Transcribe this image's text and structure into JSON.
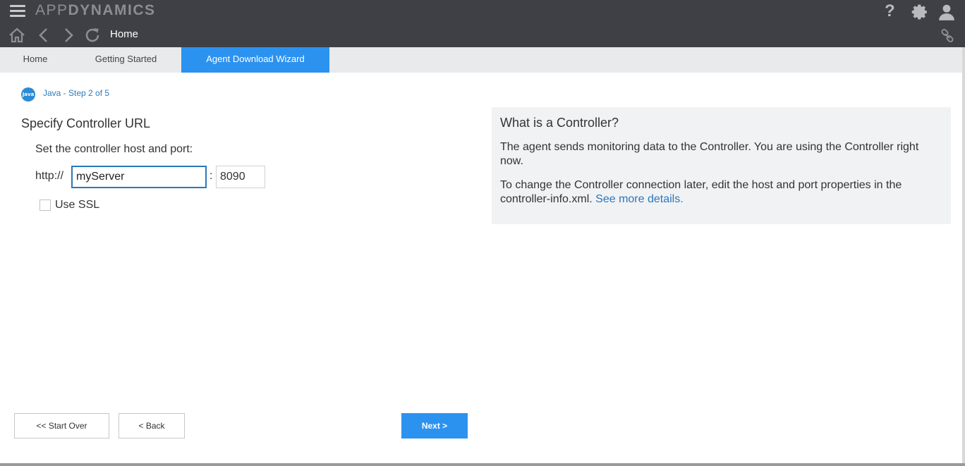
{
  "header": {
    "brand_light": "APP",
    "brand_bold": "DYNAMICS",
    "help_glyph": "?",
    "page_title": "Home",
    "icons": [
      "hamburger-menu-icon",
      "help-icon",
      "gear-icon",
      "user-icon",
      "home-icon",
      "back-arrow-icon",
      "forward-arrow-icon",
      "refresh-icon",
      "link-icon"
    ]
  },
  "tabs": [
    {
      "label": "Home",
      "active": false
    },
    {
      "label": "Getting Started",
      "active": false
    },
    {
      "label": "Agent Download Wizard",
      "active": true
    }
  ],
  "step": {
    "badge": "Java",
    "text": "Java - Step 2 of 5"
  },
  "form": {
    "title": "Specify Controller URL",
    "instructions": "Set the controller host and port:",
    "protocol": "http://",
    "host_value": "myServer",
    "separator": ":",
    "port_value": "8090",
    "ssl_label": "Use SSL",
    "ssl_checked": false
  },
  "info": {
    "title": "What is a Controller?",
    "p1": "The agent sends monitoring data to the Controller. You are using the Controller right now.",
    "p2": "To change the Controller connection later, edit the host and port properties in the controller-info.xml.",
    "link": "See more details."
  },
  "buttons": {
    "start_over": "<< Start Over",
    "back": "< Back",
    "next": "Next >"
  },
  "colors": {
    "topbar": "#3e4045",
    "accent": "#2c92f0",
    "link": "#2b76bd"
  }
}
